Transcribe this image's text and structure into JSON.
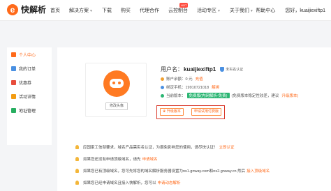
{
  "header": {
    "logo_glyph": "e",
    "logo_text": "快解析",
    "nav": [
      {
        "label": "首页",
        "has_caret": false
      },
      {
        "label": "解决方案",
        "has_caret": true
      },
      {
        "label": "下载",
        "has_caret": false
      },
      {
        "label": "购买",
        "has_caret": false
      },
      {
        "label": "代理合作",
        "has_caret": false
      },
      {
        "label": "云控制台",
        "has_caret": false
      },
      {
        "label": "活动专区",
        "has_caret": true
      },
      {
        "label": "关于我们",
        "has_caret": true
      }
    ],
    "hot_badge": "HOT",
    "help": "帮助中心",
    "greeting": "您好，kuaijiexiftp1"
  },
  "sidebar": {
    "items": [
      {
        "label": "个人中心",
        "active": true,
        "icon": "user-icon",
        "color": "#ff6a1a"
      },
      {
        "label": "我的订单",
        "active": false,
        "icon": "order-icon",
        "color": "#4a90e2"
      },
      {
        "label": "优惠券",
        "active": false,
        "icon": "coupon-icon",
        "color": "#e74c3c"
      },
      {
        "label": "活动详情",
        "active": false,
        "icon": "activity-icon",
        "color": "#f39c12"
      },
      {
        "label": "地址管理",
        "active": false,
        "icon": "address-icon",
        "color": "#27ae60"
      }
    ]
  },
  "profile": {
    "avatar_button": "修改头像",
    "username_label": "用户名：",
    "username": "kuaijiexiftp1",
    "verify_status": "未实名认证",
    "balance_label": "账户余额：0 元",
    "recharge": "充值",
    "phone_label": "绑定手机：19910721018",
    "unbind": "解绑",
    "plan_label": "当前版本：",
    "plan_tag": "免费版(内网解析-免费)",
    "plan_note": "(免费版本稳定性较差，建议",
    "upgrade_link": "升级版本)",
    "btn_upgrade": "升级版本",
    "btn_trial": "申请试用付费版"
  },
  "notes": [
    {
      "text": "应国家工信部要求，域名产品需实名认证，为避免影响您的使用，请尽快认证！",
      "link": "立即认证"
    },
    {
      "text": "如果您还没有申请顶级域名，请先",
      "link": "申请域名"
    },
    {
      "text": "如果您已有顶级域名，您可先将您的域名解析服务器设置为ns1.gnway.com和ns2.gnway.cn 然后",
      "link": "接入顶级域名"
    },
    {
      "text": "如果您已经申请域名且接入快解析，您可以",
      "link": "申请动态解析"
    }
  ],
  "colors": {
    "brand": "#ff6a1a",
    "highlight": "#d93a2b",
    "plan": "#2bb673"
  }
}
